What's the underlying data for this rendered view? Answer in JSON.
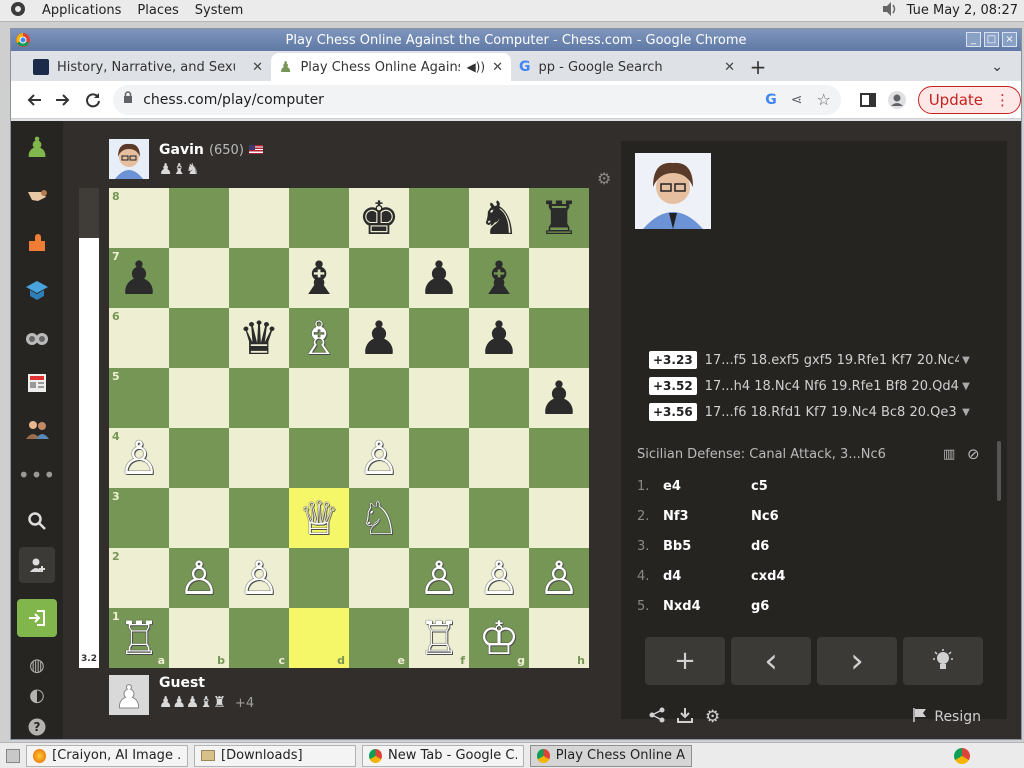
{
  "panel": {
    "menus": [
      "Applications",
      "Places",
      "System"
    ],
    "clock": "Tue May  2, 08:27"
  },
  "window": {
    "title": "Play Chess Online Against the Computer - Chess.com - Google Chrome"
  },
  "tabs": [
    {
      "label": "History, Narrative, and Sexual",
      "active": false
    },
    {
      "label": "Play Chess Online Agains",
      "active": true
    },
    {
      "label": "pp - Google Search",
      "active": false
    }
  ],
  "toolbar": {
    "url": "chess.com/play/computer",
    "update_label": "Update"
  },
  "game": {
    "opponent": {
      "name": "Gavin",
      "rating": "(650)",
      "captured": "♟♝♞"
    },
    "player": {
      "name": "Guest",
      "captured": "♟♟♟♝♜",
      "material": "+4"
    },
    "eval": "3.2",
    "files": [
      "a",
      "b",
      "c",
      "d",
      "e",
      "f",
      "g",
      "h"
    ],
    "ranks": [
      "8",
      "7",
      "6",
      "5",
      "4",
      "3",
      "2",
      "1"
    ],
    "pieces": [
      {
        "sq": "e8",
        "p": "♚",
        "c": "b"
      },
      {
        "sq": "g8",
        "p": "♞",
        "c": "b"
      },
      {
        "sq": "h8",
        "p": "♜",
        "c": "b"
      },
      {
        "sq": "a7",
        "p": "♟",
        "c": "b"
      },
      {
        "sq": "d7",
        "p": "♝",
        "c": "b"
      },
      {
        "sq": "f7",
        "p": "♟",
        "c": "b"
      },
      {
        "sq": "g7",
        "p": "♝",
        "c": "b"
      },
      {
        "sq": "c6",
        "p": "♛",
        "c": "b"
      },
      {
        "sq": "d6",
        "p": "♗",
        "c": "w"
      },
      {
        "sq": "e6",
        "p": "♟",
        "c": "b"
      },
      {
        "sq": "g6",
        "p": "♟",
        "c": "b"
      },
      {
        "sq": "h5",
        "p": "♟",
        "c": "b"
      },
      {
        "sq": "a4",
        "p": "♙",
        "c": "w"
      },
      {
        "sq": "e4",
        "p": "♙",
        "c": "w"
      },
      {
        "sq": "d3",
        "p": "♕",
        "c": "w"
      },
      {
        "sq": "e3",
        "p": "♘",
        "c": "w"
      },
      {
        "sq": "b2",
        "p": "♙",
        "c": "w"
      },
      {
        "sq": "c2",
        "p": "♙",
        "c": "w"
      },
      {
        "sq": "f2",
        "p": "♙",
        "c": "w"
      },
      {
        "sq": "g2",
        "p": "♙",
        "c": "w"
      },
      {
        "sq": "h2",
        "p": "♙",
        "c": "w"
      },
      {
        "sq": "a1",
        "p": "♖",
        "c": "w"
      },
      {
        "sq": "f1",
        "p": "♖",
        "c": "w"
      },
      {
        "sq": "g1",
        "p": "♔",
        "c": "w"
      }
    ],
    "highlighted": [
      "d3",
      "d1"
    ]
  },
  "analysis": {
    "lines": [
      {
        "score": "+3.23",
        "text": "17...f5 18.exf5 gxf5 19.Rfe1 Kf7 20.Nc4 …"
      },
      {
        "score": "+3.52",
        "text": "17...h4 18.Nc4 Nf6 19.Rfe1 Bf8 20.Qd4 …"
      },
      {
        "score": "+3.56",
        "text": "17...f6 18.Rfd1 Kf7 19.Nc4 Bc8 20.Qe3 …"
      }
    ],
    "opening": "Sicilian Defense: Canal Attack, 3...Nc6",
    "moves": [
      {
        "n": "1.",
        "w": "e4",
        "b": "c5"
      },
      {
        "n": "2.",
        "w": "Nf3",
        "b": "Nc6"
      },
      {
        "n": "3.",
        "w": "Bb5",
        "b": "d6"
      },
      {
        "n": "4.",
        "w": "d4",
        "b": "cxd4"
      },
      {
        "n": "5.",
        "w": "Nxd4",
        "b": "g6"
      }
    ],
    "controls": {
      "add": "+",
      "prev": "‹",
      "next": "›",
      "hint": "💡"
    },
    "resign_label": "Resign"
  },
  "taskbar": [
    {
      "label": "[Craiyon, AI Image ...",
      "icon": "firefox-icon"
    },
    {
      "label": "[Downloads]",
      "icon": "folder-icon"
    },
    {
      "label": "New Tab - Google C...",
      "icon": "chrome-icon"
    },
    {
      "label": "Play Chess Online A...",
      "icon": "chrome-icon",
      "active": true
    }
  ],
  "colors": {
    "light_square": "#eeeed2",
    "dark_square": "#769656",
    "highlight": "#f6f669",
    "update": "#c5221f"
  }
}
